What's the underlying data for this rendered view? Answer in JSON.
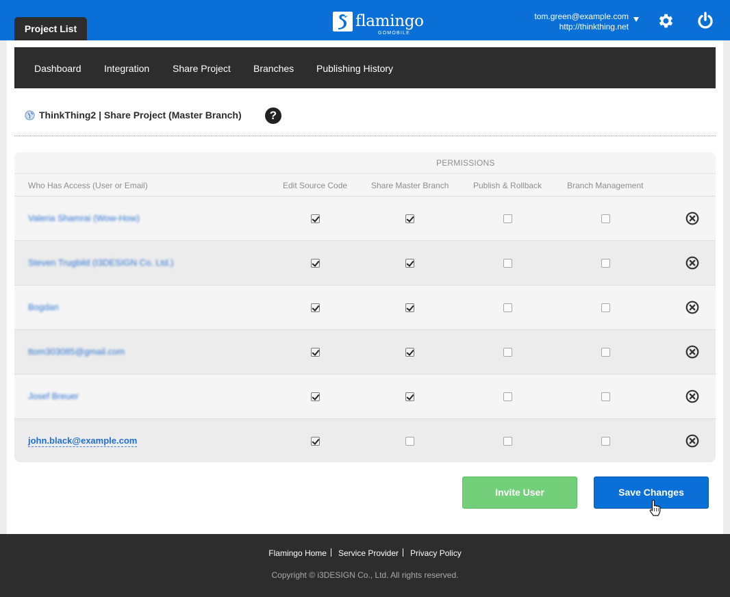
{
  "header": {
    "tab_label": "Project List",
    "logo_word": "flamingo",
    "logo_sub": "GOMOBILE",
    "user_email": "tom.green@example.com",
    "user_site": "http://thinkthing.net",
    "icons": [
      "chevron-down-icon",
      "gear-icon",
      "power-icon"
    ],
    "brand_color": "#0a6fd6"
  },
  "subnav": {
    "items": [
      {
        "label": "Dashboard"
      },
      {
        "label": "Integration"
      },
      {
        "label": "Share Project"
      },
      {
        "label": "Branches"
      },
      {
        "label": "Publishing History"
      }
    ]
  },
  "page": {
    "title": "ThinkThing2 | Share Project (Master Branch)",
    "help_label": "?"
  },
  "table": {
    "permissions_label": "PERMISSIONS",
    "columns": [
      "Who Has Access (User or Email)",
      "Edit Source Code",
      "Share Master Branch",
      "Publish & Rollback",
      "Branch Management"
    ],
    "rows": [
      {
        "user": "Valeria Shamrai (Wow-How)",
        "blurred": true,
        "perms": [
          true,
          true,
          false,
          false
        ]
      },
      {
        "user": "Steven Trugbild (I3DESIGN Co. Ltd.)",
        "blurred": true,
        "perms": [
          true,
          true,
          false,
          false
        ]
      },
      {
        "user": "Bogdan",
        "blurred": true,
        "perms": [
          true,
          true,
          false,
          false
        ]
      },
      {
        "user": "ttom303085@gmail.com",
        "blurred": true,
        "perms": [
          true,
          true,
          false,
          false
        ]
      },
      {
        "user": "Josef Breuer",
        "blurred": true,
        "perms": [
          true,
          true,
          false,
          false
        ]
      },
      {
        "user": "john.black@example.com",
        "blurred": false,
        "perms": [
          true,
          false,
          false,
          false
        ]
      }
    ]
  },
  "actions": {
    "invite_label": "Invite User",
    "save_label": "Save Changes",
    "invite_color": "#74cf7a",
    "save_color": "#0a6fd6"
  },
  "footer": {
    "links": [
      "Flamingo Home",
      "Service Provider",
      "Privacy Policy"
    ],
    "copyright": "Copyright © i3DESIGN Co., Ltd. All rights reserved."
  }
}
